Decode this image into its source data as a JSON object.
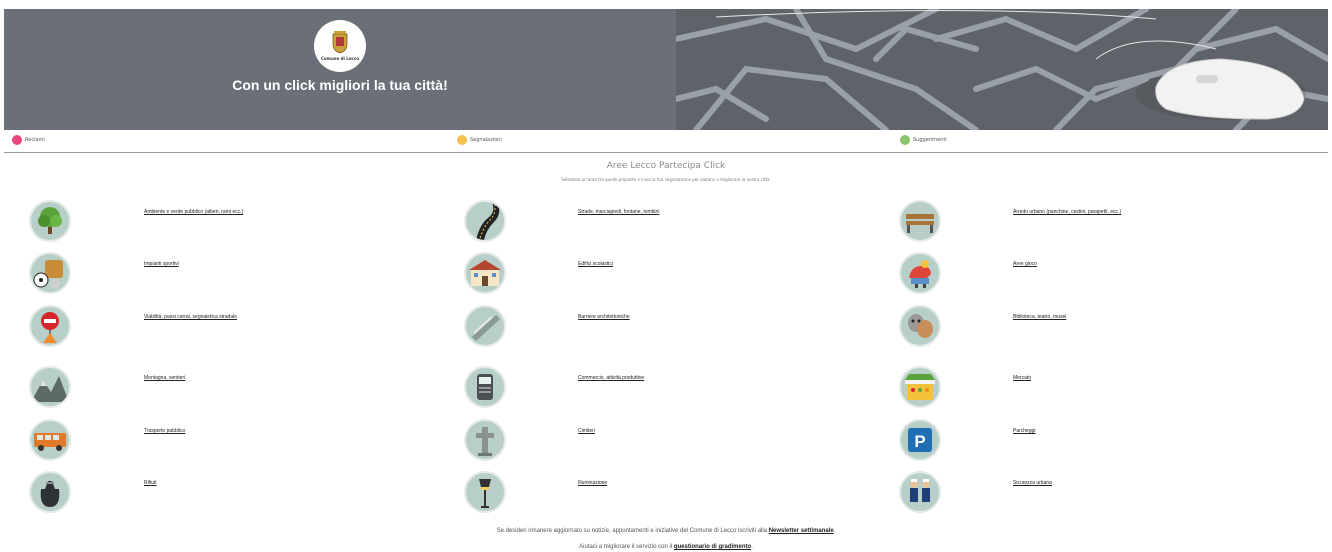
{
  "banner": {
    "logo_text": "Comune di Lecco",
    "tagline": "Con un click migliori la tua città!"
  },
  "legend": [
    {
      "label": "Reclami",
      "color": "#e8467c"
    },
    {
      "label": "Segnalazioni",
      "color": "#f6c14f"
    },
    {
      "label": "Suggerimenti",
      "color": "#8cc56b"
    }
  ],
  "section": {
    "title": "Aree Lecco Partecipa Click",
    "subtitle": "Seleziona un'area tra quelle proposte e invia la tua segnalazione per aiutarci a migliorare la nostra città."
  },
  "categories": [
    {
      "label": "Ambiente e verde pubblico (alberi, rami ecc.)",
      "icon": "tree-icon"
    },
    {
      "label": "Strade, marciapiedi, fontane, tombini",
      "icon": "road-icon"
    },
    {
      "label": "Arredo urbano (panchine, cestini, parapetti, ecc.)",
      "icon": "bench-icon"
    },
    {
      "label": "Impianti sportivi",
      "icon": "sports-icon"
    },
    {
      "label": "Edifici scolastici",
      "icon": "school-icon"
    },
    {
      "label": "Aree gioco",
      "icon": "playground-icon"
    },
    {
      "label": "Viabilità, passi carrai, segnaletica stradale",
      "icon": "road-sign-icon"
    },
    {
      "label": "Barriere architettoniche",
      "icon": "ramp-icon"
    },
    {
      "label": "Biblioteca, teatro, musei",
      "icon": "theatre-icon"
    },
    {
      "label": "Montagna, sentieri",
      "icon": "mountain-icon"
    },
    {
      "label": "Commercio, attività produttive",
      "icon": "shop-terminal-icon"
    },
    {
      "label": "Mercato",
      "icon": "market-icon"
    },
    {
      "label": "Trasporto pubblico",
      "icon": "bus-icon"
    },
    {
      "label": "Cimiteri",
      "icon": "cross-icon"
    },
    {
      "label": "Parcheggi",
      "icon": "parking-icon"
    },
    {
      "label": "Rifiuti",
      "icon": "trash-bag-icon"
    },
    {
      "label": "Illuminazione",
      "icon": "streetlamp-icon"
    },
    {
      "label": "Sicurezza urbana",
      "icon": "police-icon"
    }
  ],
  "footer": {
    "newsletter_text": "Se desideri rimanere aggiornato su notizie, appuntamenti e iniziative del Comune di Lecco iscriviti alla",
    "newsletter_link": "Newsletter settimanale",
    "survey_text": "Aiutaci a migliorare il servizio con il",
    "survey_link": "questionario di gradimento"
  }
}
